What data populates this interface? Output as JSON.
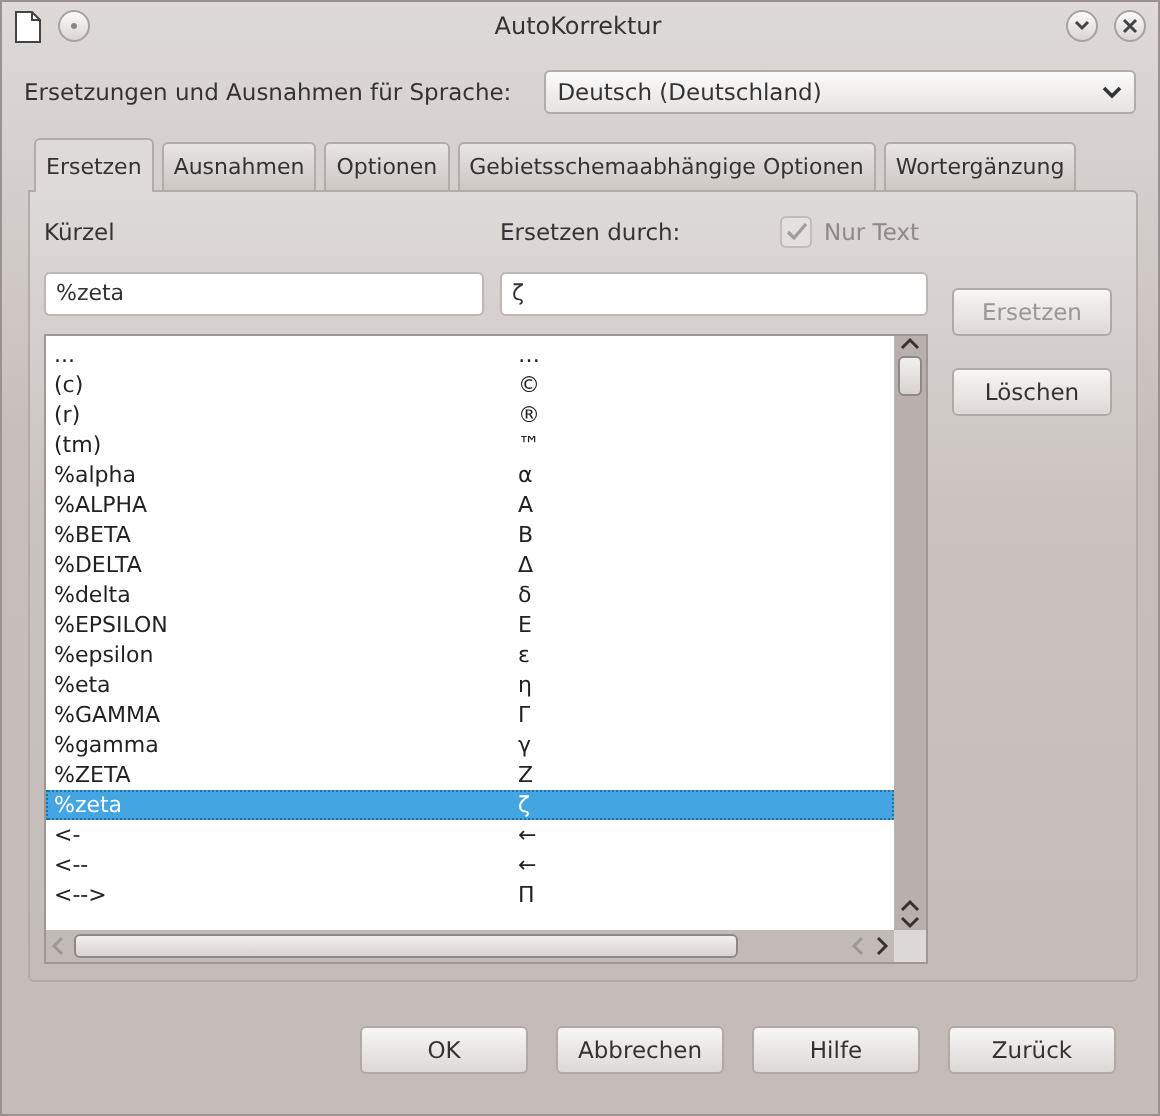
{
  "window": {
    "title": "AutoKorrektur"
  },
  "language": {
    "label": "Ersetzungen und Ausnahmen für Sprache:",
    "value": "Deutsch (Deutschland)"
  },
  "tabs": [
    {
      "label": "Ersetzen",
      "selected": true
    },
    {
      "label": "Ausnahmen",
      "selected": false
    },
    {
      "label": "Optionen",
      "selected": false
    },
    {
      "label": "Gebietsschemaabhängige Optionen",
      "selected": false
    },
    {
      "label": "Wortergänzung",
      "selected": false
    }
  ],
  "shortcut": {
    "label": "Kürzel",
    "value": "%zeta"
  },
  "replace_with": {
    "label": "Ersetzen durch:",
    "value": "ζ"
  },
  "text_only": {
    "label": "Nur Text",
    "checked": true,
    "disabled": true
  },
  "side_buttons": [
    {
      "label": "Ersetzen",
      "disabled": true
    },
    {
      "label": "Löschen",
      "disabled": false
    }
  ],
  "rows": [
    {
      "short": "...",
      "replacement": "…",
      "selected": false
    },
    {
      "short": "(c)",
      "replacement": "©",
      "selected": false
    },
    {
      "short": "(r)",
      "replacement": "®",
      "selected": false
    },
    {
      "short": "(tm)",
      "replacement": "™",
      "selected": false
    },
    {
      "short": "%alpha",
      "replacement": "α",
      "selected": false
    },
    {
      "short": "%ALPHA",
      "replacement": "Α",
      "selected": false
    },
    {
      "short": "%BETA",
      "replacement": "Β",
      "selected": false
    },
    {
      "short": "%DELTA",
      "replacement": "Δ",
      "selected": false
    },
    {
      "short": "%delta",
      "replacement": "δ",
      "selected": false
    },
    {
      "short": "%EPSILON",
      "replacement": "Ε",
      "selected": false
    },
    {
      "short": "%epsilon",
      "replacement": "ε",
      "selected": false
    },
    {
      "short": "%eta",
      "replacement": "η",
      "selected": false
    },
    {
      "short": "%GAMMA",
      "replacement": "Γ",
      "selected": false
    },
    {
      "short": "%gamma",
      "replacement": "γ",
      "selected": false
    },
    {
      "short": "%ZETA",
      "replacement": "Ζ",
      "selected": false
    },
    {
      "short": "%zeta",
      "replacement": "ζ",
      "selected": true
    },
    {
      "short": "<-",
      "replacement": "←",
      "selected": false
    },
    {
      "short": "<--",
      "replacement": "←",
      "selected": false
    },
    {
      "short": "<-->",
      "replacement": "Π",
      "selected": false
    }
  ],
  "buttons": [
    "OK",
    "Abbrechen",
    "Hilfe",
    "Zurück"
  ]
}
